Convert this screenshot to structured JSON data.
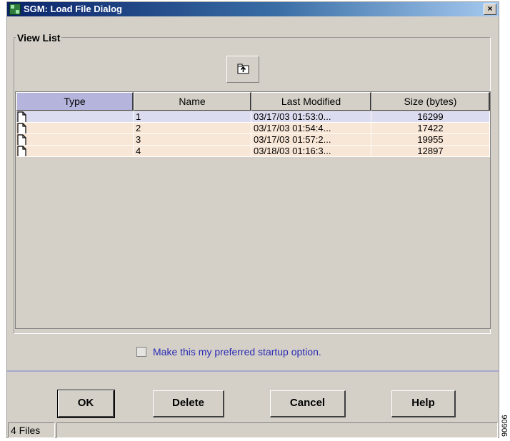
{
  "window": {
    "title": "SGM: Load File Dialog",
    "close_label": "×"
  },
  "view_list": {
    "label": "View List",
    "up_button_icon": "up-folder-icon"
  },
  "table": {
    "columns": [
      "Type",
      "Name",
      "Last Modified",
      "Size (bytes)"
    ],
    "sorted_column": "Type",
    "rows": [
      {
        "type_icon": "file-icon",
        "name": "1",
        "modified": "03/17/03  01:53:0...",
        "size": "16299",
        "selected": true
      },
      {
        "type_icon": "file-icon",
        "name": "2",
        "modified": "03/17/03  01:54:4...",
        "size": "17422",
        "selected": false
      },
      {
        "type_icon": "file-icon",
        "name": "3",
        "modified": "03/17/03  01:57:2...",
        "size": "19955",
        "selected": false
      },
      {
        "type_icon": "file-icon",
        "name": "4",
        "modified": "03/18/03  01:16:3...",
        "size": "12897",
        "selected": false
      }
    ]
  },
  "startup_option": {
    "label": "Make this my preferred startup option.",
    "checked": false
  },
  "buttons": {
    "ok": "OK",
    "delete": "Delete",
    "cancel": "Cancel",
    "help": "Help"
  },
  "status_bar": {
    "file_count": "4 Files",
    "message": ""
  },
  "figure_id": "90606",
  "colors": {
    "selected_row": "#dcdcf0",
    "unselected_row": "#f8e6d6",
    "active_header": "#b4b4dc",
    "dialog_bg": "#d4d0c8",
    "link_text": "#2b2bb4"
  }
}
